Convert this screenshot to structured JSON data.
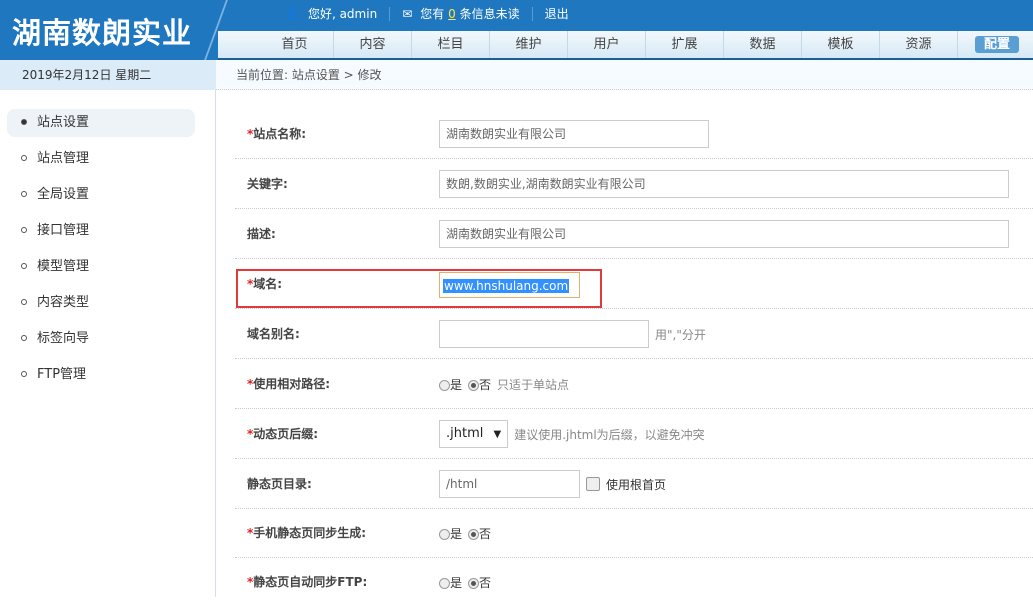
{
  "header": {
    "logo": "湖南数朗实业",
    "greeting": "您好, admin",
    "msg_prefix": "您有",
    "msg_count": "0",
    "msg_suffix": "条信息未读",
    "logout": "退出"
  },
  "nav": [
    "首页",
    "内容",
    "栏目",
    "维护",
    "用户",
    "扩展",
    "数据",
    "模板",
    "资源",
    "配置"
  ],
  "date": "2019年2月12日 星期二",
  "breadcrumb": "当前位置: 站点设置 > 修改",
  "sidebar": [
    "站点设置",
    "站点管理",
    "全局设置",
    "接口管理",
    "模型管理",
    "内容类型",
    "标签向导",
    "FTP管理"
  ],
  "form": {
    "site_name": {
      "label": "站点名称:",
      "value": "湖南数朗实业有限公司"
    },
    "keywords": {
      "label": "关键字:",
      "value": "数朗,数朗实业,湖南数朗实业有限公司"
    },
    "description": {
      "label": "描述:",
      "value": "湖南数朗实业有限公司"
    },
    "domain": {
      "label": "域名:",
      "value": "www.hnshulang.com"
    },
    "alias": {
      "label": "域名别名:",
      "value": "",
      "hint": "用\",\"分开"
    },
    "relative": {
      "label": "使用相对路径:",
      "yes": "是",
      "no": "否",
      "hint": "只适于单站点"
    },
    "suffix": {
      "label": "动态页后缀:",
      "value": ".jhtml",
      "hint": "建议使用.jhtml为后缀，以避免冲突"
    },
    "static_dir": {
      "label": "静态页目录:",
      "value": "/html",
      "check": "使用根首页"
    },
    "mobile_sync": {
      "label": "手机静态页同步生成:",
      "yes": "是",
      "no": "否"
    },
    "ftp_sync": {
      "label": "静态页自动同步FTP:",
      "yes": "是",
      "no": "否"
    }
  }
}
